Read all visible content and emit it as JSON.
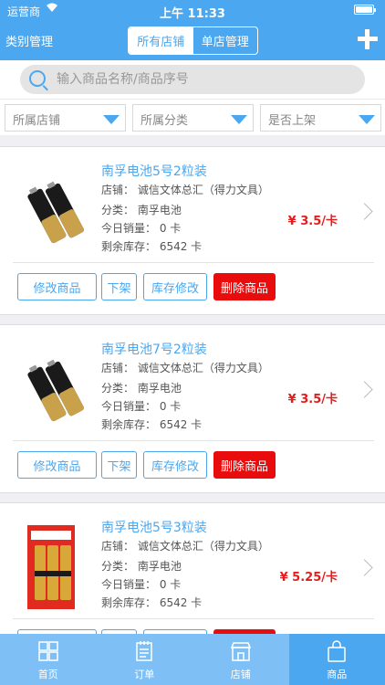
{
  "status_bar": {
    "carrier": "运营商",
    "time": "上午 11:33"
  },
  "header": {
    "left_label": "类别管理",
    "segments": [
      "所有店铺",
      "单店管理"
    ],
    "active_segment": 0
  },
  "search": {
    "placeholder": "输入商品名称/商品序号"
  },
  "filters": [
    {
      "label": "所属店铺"
    },
    {
      "label": "所属分类"
    },
    {
      "label": "是否上架"
    }
  ],
  "products": [
    {
      "title": "南孚电池5号2粒装",
      "store": "店铺：  诚信文体总汇（得力文具）",
      "category": "分类：  南孚电池",
      "sales": "今日销量：  0 卡",
      "stock": "剩余库存：  6542 卡",
      "price": "¥ 3.5/卡",
      "image": "aa-battery-pair"
    },
    {
      "title": "南孚电池7号2粒装",
      "store": "店铺：  诚信文体总汇（得力文具）",
      "category": "分类：  南孚电池",
      "sales": "今日销量：  0 卡",
      "stock": "剩余库存：  6542 卡",
      "price": "¥ 3.5/卡",
      "image": "aa-battery-pair"
    },
    {
      "title": "南孚电池5号3粒装",
      "store": "店铺：  诚信文体总汇（得力文具）",
      "category": "分类：  南孚电池",
      "sales": "今日销量：  0 卡",
      "stock": "剩余库存：  6542 卡",
      "price": "¥ 5.25/卡",
      "image": "battery-blister-pack"
    }
  ],
  "actions": {
    "edit": "修改商品",
    "unlist": "下架",
    "stock": "库存修改",
    "delete": "删除商品"
  },
  "tabbar": [
    {
      "label": "首页",
      "icon": "grid-icon"
    },
    {
      "label": "订单",
      "icon": "order-icon"
    },
    {
      "label": "店铺",
      "icon": "store-icon"
    },
    {
      "label": "商品",
      "icon": "bag-icon"
    }
  ],
  "active_tab": 3,
  "colors": {
    "primary": "#4aa7f0",
    "danger": "#e80c0c",
    "price": "#e41c1c",
    "tabbar": "#7ec0f6"
  }
}
